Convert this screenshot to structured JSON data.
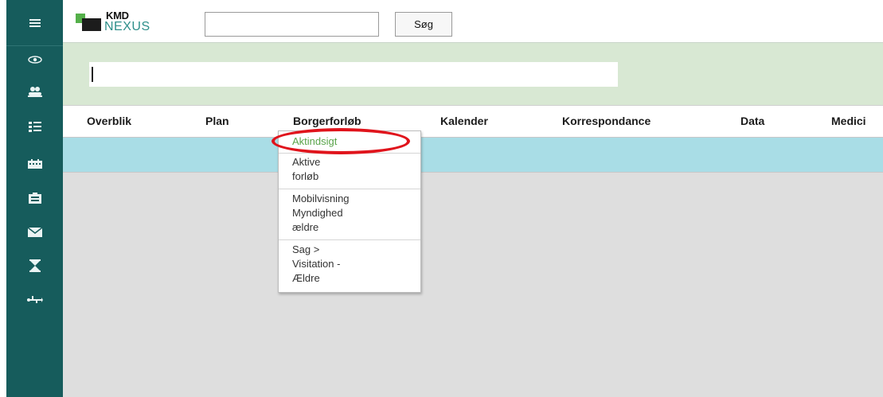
{
  "rail": {
    "icons": [
      "menu-icon",
      "eye-icon",
      "users-icon",
      "list-icon",
      "calendar-icon",
      "case-icon",
      "mail-icon",
      "hourglass-icon",
      "usb-icon"
    ]
  },
  "header": {
    "logo_kmd": "KMD",
    "logo_nexus": "NEXUS",
    "search_value": "",
    "search_button": "Søg"
  },
  "citizen": {
    "value": ""
  },
  "tabs": [
    "Overblik",
    "Plan",
    "Borgerforløb",
    "Kalender",
    "Korrespondance",
    "Data",
    "Medici"
  ],
  "dropdown": {
    "items": [
      [
        "Aktindsigt"
      ],
      [
        "Aktive",
        "forløb"
      ],
      [
        "Mobilvisning",
        "Myndighed",
        "ældre"
      ],
      [
        "Sag >",
        "Visitation -",
        "Ældre"
      ]
    ],
    "active_index": 0
  },
  "colors": {
    "rail": "#165c5c",
    "citizen_bar": "#d8e8d3",
    "blue_strip": "#a9dde6",
    "content": "#dedede",
    "accent_green": "#5aa44a",
    "annotation_red": "#e0141c"
  }
}
